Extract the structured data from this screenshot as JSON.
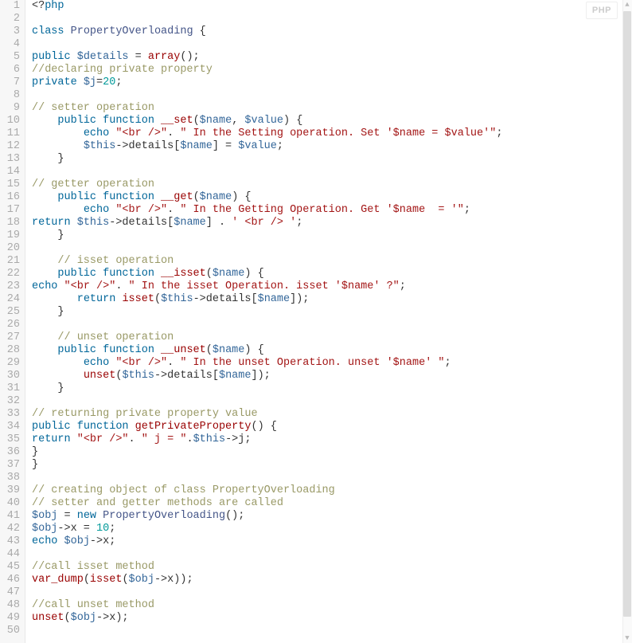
{
  "language_badge": "PHP",
  "line_count": 50,
  "code_lines": [
    {
      "n": 1,
      "tokens": [
        [
          "p",
          "<?"
        ],
        [
          "k",
          "php"
        ]
      ]
    },
    {
      "n": 2,
      "tokens": []
    },
    {
      "n": 3,
      "tokens": [
        [
          "k",
          "class"
        ],
        [
          "p",
          " "
        ],
        [
          "t",
          "PropertyOverloading"
        ],
        [
          "p",
          " {"
        ]
      ]
    },
    {
      "n": 4,
      "tokens": []
    },
    {
      "n": 5,
      "tokens": [
        [
          "k",
          "public"
        ],
        [
          "p",
          " "
        ],
        [
          "v",
          "$details"
        ],
        [
          "p",
          " = "
        ],
        [
          "f",
          "array"
        ],
        [
          "p",
          "();"
        ]
      ]
    },
    {
      "n": 6,
      "tokens": [
        [
          "c",
          "//declaring private property"
        ]
      ]
    },
    {
      "n": 7,
      "tokens": [
        [
          "k",
          "private"
        ],
        [
          "p",
          " "
        ],
        [
          "v",
          "$j"
        ],
        [
          "p",
          "="
        ],
        [
          "n",
          "20"
        ],
        [
          "p",
          ";"
        ]
      ]
    },
    {
      "n": 8,
      "tokens": []
    },
    {
      "n": 9,
      "tokens": [
        [
          "c",
          "// setter operation"
        ]
      ]
    },
    {
      "n": 10,
      "tokens": [
        [
          "p",
          "    "
        ],
        [
          "k",
          "public"
        ],
        [
          "p",
          " "
        ],
        [
          "k",
          "function"
        ],
        [
          "p",
          " "
        ],
        [
          "f",
          "__set"
        ],
        [
          "p",
          "("
        ],
        [
          "v",
          "$name"
        ],
        [
          "p",
          ", "
        ],
        [
          "v",
          "$value"
        ],
        [
          "p",
          ") {"
        ]
      ]
    },
    {
      "n": 11,
      "tokens": [
        [
          "p",
          "        "
        ],
        [
          "k",
          "echo"
        ],
        [
          "p",
          " "
        ],
        [
          "s",
          "\"<br />\""
        ],
        [
          "p",
          ". "
        ],
        [
          "s",
          "\" In the Setting operation. Set '$name = $value'\""
        ],
        [
          "p",
          ";"
        ]
      ]
    },
    {
      "n": 12,
      "tokens": [
        [
          "p",
          "        "
        ],
        [
          "v",
          "$this"
        ],
        [
          "p",
          "->details["
        ],
        [
          "v",
          "$name"
        ],
        [
          "p",
          "] = "
        ],
        [
          "v",
          "$value"
        ],
        [
          "p",
          ";"
        ]
      ]
    },
    {
      "n": 13,
      "tokens": [
        [
          "p",
          "    }"
        ]
      ]
    },
    {
      "n": 14,
      "tokens": []
    },
    {
      "n": 15,
      "tokens": [
        [
          "c",
          "// getter operation"
        ]
      ]
    },
    {
      "n": 16,
      "tokens": [
        [
          "p",
          "    "
        ],
        [
          "k",
          "public"
        ],
        [
          "p",
          " "
        ],
        [
          "k",
          "function"
        ],
        [
          "p",
          " "
        ],
        [
          "f",
          "__get"
        ],
        [
          "p",
          "("
        ],
        [
          "v",
          "$name"
        ],
        [
          "p",
          ") {"
        ]
      ]
    },
    {
      "n": 17,
      "tokens": [
        [
          "p",
          "        "
        ],
        [
          "k",
          "echo"
        ],
        [
          "p",
          " "
        ],
        [
          "s",
          "\"<br />\""
        ],
        [
          "p",
          ". "
        ],
        [
          "s",
          "\" In the Getting Operation. Get '$name  = '\""
        ],
        [
          "p",
          ";"
        ]
      ]
    },
    {
      "n": 18,
      "tokens": [
        [
          "k",
          "return"
        ],
        [
          "p",
          " "
        ],
        [
          "v",
          "$this"
        ],
        [
          "p",
          "->details["
        ],
        [
          "v",
          "$name"
        ],
        [
          "p",
          "] . "
        ],
        [
          "s",
          "' <br /> '"
        ],
        [
          "p",
          ";"
        ]
      ]
    },
    {
      "n": 19,
      "tokens": [
        [
          "p",
          "    }"
        ]
      ]
    },
    {
      "n": 20,
      "tokens": []
    },
    {
      "n": 21,
      "tokens": [
        [
          "p",
          "    "
        ],
        [
          "c",
          "// isset operation"
        ]
      ]
    },
    {
      "n": 22,
      "tokens": [
        [
          "p",
          "    "
        ],
        [
          "k",
          "public"
        ],
        [
          "p",
          " "
        ],
        [
          "k",
          "function"
        ],
        [
          "p",
          " "
        ],
        [
          "f",
          "__isset"
        ],
        [
          "p",
          "("
        ],
        [
          "v",
          "$name"
        ],
        [
          "p",
          ") {"
        ]
      ]
    },
    {
      "n": 23,
      "tokens": [
        [
          "k",
          "echo"
        ],
        [
          "p",
          " "
        ],
        [
          "s",
          "\"<br />\""
        ],
        [
          "p",
          ". "
        ],
        [
          "s",
          "\" In the isset Operation. isset '$name' ?\""
        ],
        [
          "p",
          ";"
        ]
      ]
    },
    {
      "n": 24,
      "tokens": [
        [
          "p",
          "       "
        ],
        [
          "k",
          "return"
        ],
        [
          "p",
          " "
        ],
        [
          "f",
          "isset"
        ],
        [
          "p",
          "("
        ],
        [
          "v",
          "$this"
        ],
        [
          "p",
          "->details["
        ],
        [
          "v",
          "$name"
        ],
        [
          "p",
          "]);"
        ]
      ]
    },
    {
      "n": 25,
      "tokens": [
        [
          "p",
          "    }"
        ]
      ]
    },
    {
      "n": 26,
      "tokens": []
    },
    {
      "n": 27,
      "tokens": [
        [
          "p",
          "    "
        ],
        [
          "c",
          "// unset operation"
        ]
      ]
    },
    {
      "n": 28,
      "tokens": [
        [
          "p",
          "    "
        ],
        [
          "k",
          "public"
        ],
        [
          "p",
          " "
        ],
        [
          "k",
          "function"
        ],
        [
          "p",
          " "
        ],
        [
          "f",
          "__unset"
        ],
        [
          "p",
          "("
        ],
        [
          "v",
          "$name"
        ],
        [
          "p",
          ") {"
        ]
      ]
    },
    {
      "n": 29,
      "tokens": [
        [
          "p",
          "        "
        ],
        [
          "k",
          "echo"
        ],
        [
          "p",
          " "
        ],
        [
          "s",
          "\"<br />\""
        ],
        [
          "p",
          ". "
        ],
        [
          "s",
          "\" In the unset Operation. unset '$name' \""
        ],
        [
          "p",
          ";"
        ]
      ]
    },
    {
      "n": 30,
      "tokens": [
        [
          "p",
          "        "
        ],
        [
          "f",
          "unset"
        ],
        [
          "p",
          "("
        ],
        [
          "v",
          "$this"
        ],
        [
          "p",
          "->details["
        ],
        [
          "v",
          "$name"
        ],
        [
          "p",
          "]);"
        ]
      ]
    },
    {
      "n": 31,
      "tokens": [
        [
          "p",
          "    }"
        ]
      ]
    },
    {
      "n": 32,
      "tokens": []
    },
    {
      "n": 33,
      "tokens": [
        [
          "c",
          "// returning private property value"
        ]
      ]
    },
    {
      "n": 34,
      "tokens": [
        [
          "k",
          "public"
        ],
        [
          "p",
          " "
        ],
        [
          "k",
          "function"
        ],
        [
          "p",
          " "
        ],
        [
          "f",
          "getPrivateProperty"
        ],
        [
          "p",
          "() {"
        ]
      ]
    },
    {
      "n": 35,
      "tokens": [
        [
          "k",
          "return"
        ],
        [
          "p",
          " "
        ],
        [
          "s",
          "\"<br />\""
        ],
        [
          "p",
          ". "
        ],
        [
          "s",
          "\" j = \""
        ],
        [
          "p",
          "."
        ],
        [
          "v",
          "$this"
        ],
        [
          "p",
          "->j;"
        ]
      ]
    },
    {
      "n": 36,
      "tokens": [
        [
          "p",
          "}"
        ]
      ]
    },
    {
      "n": 37,
      "tokens": [
        [
          "p",
          "}"
        ]
      ]
    },
    {
      "n": 38,
      "tokens": []
    },
    {
      "n": 39,
      "tokens": [
        [
          "c",
          "// creating object of class PropertyOverloading"
        ]
      ]
    },
    {
      "n": 40,
      "tokens": [
        [
          "c",
          "// setter and getter methods are called"
        ]
      ]
    },
    {
      "n": 41,
      "tokens": [
        [
          "v",
          "$obj"
        ],
        [
          "p",
          " = "
        ],
        [
          "k",
          "new"
        ],
        [
          "p",
          " "
        ],
        [
          "t",
          "PropertyOverloading"
        ],
        [
          "p",
          "();"
        ]
      ]
    },
    {
      "n": 42,
      "tokens": [
        [
          "v",
          "$obj"
        ],
        [
          "p",
          "->x = "
        ],
        [
          "n",
          "10"
        ],
        [
          "p",
          ";"
        ]
      ]
    },
    {
      "n": 43,
      "tokens": [
        [
          "k",
          "echo"
        ],
        [
          "p",
          " "
        ],
        [
          "v",
          "$obj"
        ],
        [
          "p",
          "->x;"
        ]
      ]
    },
    {
      "n": 44,
      "tokens": []
    },
    {
      "n": 45,
      "tokens": [
        [
          "c",
          "//call isset method"
        ]
      ]
    },
    {
      "n": 46,
      "tokens": [
        [
          "f",
          "var_dump"
        ],
        [
          "p",
          "("
        ],
        [
          "f",
          "isset"
        ],
        [
          "p",
          "("
        ],
        [
          "v",
          "$obj"
        ],
        [
          "p",
          "->x));"
        ]
      ]
    },
    {
      "n": 47,
      "tokens": []
    },
    {
      "n": 48,
      "tokens": [
        [
          "c",
          "//call unset method"
        ]
      ]
    },
    {
      "n": 49,
      "tokens": [
        [
          "f",
          "unset"
        ],
        [
          "p",
          "("
        ],
        [
          "v",
          "$obj"
        ],
        [
          "p",
          "->x);"
        ]
      ]
    },
    {
      "n": 50,
      "tokens": []
    }
  ]
}
